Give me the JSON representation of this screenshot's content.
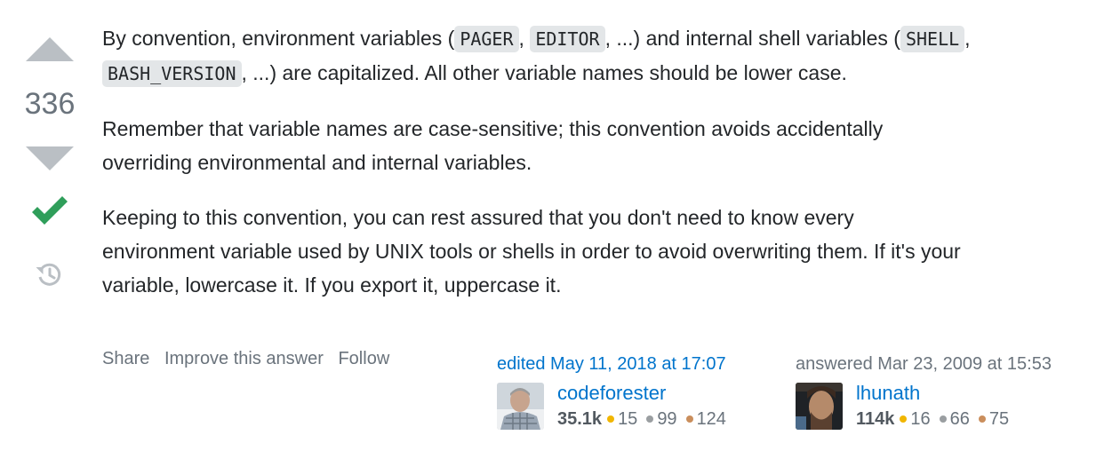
{
  "vote": {
    "score": "336",
    "upvote_label": "upvote",
    "downvote_label": "downvote"
  },
  "post": {
    "p1": {
      "t1": "By convention, environment variables (",
      "c1": "PAGER",
      "t2": ", ",
      "c2": "EDITOR",
      "t3": ", ...) and internal shell variables (",
      "c3": "SHELL",
      "t4": ",",
      "c4": "BASH_VERSION",
      "t5": ", ...) are capitalized. All other variable names should be lower case."
    },
    "p2": {
      "l1": "Remember that variable names are case-sensitive; this convention avoids accidentally",
      "l2": "overriding environmental and internal variables."
    },
    "p3": {
      "l1": "Keeping to this convention, you can rest assured that you don't need to know every",
      "l2": "environment variable used by UNIX tools or shells in order to avoid overwriting them. If it's your",
      "l3": "variable, lowercase it. If you export it, uppercase it."
    }
  },
  "menu": {
    "share": "Share",
    "improve": "Improve this answer",
    "follow": "Follow"
  },
  "editor": {
    "action": "edited May 11, 2018 at 17:07",
    "name": "codeforester",
    "reputation": "35.1k",
    "gold": "15",
    "silver": "99",
    "bronze": "124"
  },
  "owner": {
    "action": "answered Mar 23, 2009 at 15:53",
    "name": "lhunath",
    "reputation": "114k",
    "gold": "16",
    "silver": "66",
    "bronze": "75"
  },
  "colors": {
    "link": "#0074cc",
    "accepted": "#2f9e5a",
    "muted": "#6a737c",
    "code_bg": "#e3e6e8",
    "gold": "#f1b600",
    "silver": "#9a9ea1",
    "bronze": "#ca8e5c"
  },
  "icons": [
    "upvote-arrow-icon",
    "downvote-arrow-icon",
    "accepted-checkmark-icon",
    "history-icon"
  ]
}
